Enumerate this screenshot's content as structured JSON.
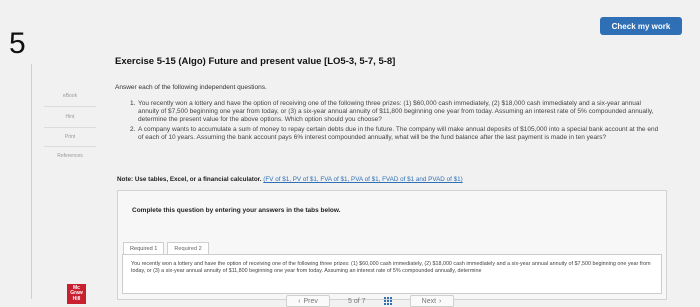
{
  "header": {
    "check_button": "Check my work",
    "question_number": "5"
  },
  "sidebar": {
    "items": [
      {
        "label": "eBook"
      },
      {
        "label": "Hint"
      },
      {
        "label": "Print"
      },
      {
        "label": "References"
      }
    ]
  },
  "exercise": {
    "title": "Exercise 5-15 (Algo) Future and present value [LO5-3, 5-7, 5-8]",
    "intro": "Answer each of the following independent questions.",
    "questions": [
      {
        "num": "1.",
        "text": "You recently won a lottery and have the option of receiving one of the following three prizes: (1) $60,000 cash immediately, (2) $18,000 cash immediately and a six-year annual annuity of $7,500 beginning one year from today, or (3) a six-year annual annuity of $11,800 beginning one year from today. Assuming an interest rate of 5% compounded annually, determine the present value for the above options. Which option should you choose?"
      },
      {
        "num": "2.",
        "text": "A company wants to accumulate a sum of money to repay certain debts due in the future. The company will make annual deposits of $105,000 into a special bank account at the end of each of 10 years. Assuming the bank account pays 6% interest compounded annually, what will be the fund balance after the last payment is made in ten years?"
      }
    ],
    "note_label": "Note: Use tables, Excel, or a financial calculator.",
    "note_links": "(FV of $1, PV of $1, FVA of $1, PVA of $1, FVAD of $1 and PVAD of $1)"
  },
  "answer_panel": {
    "instruction": "Complete this question by entering your answers in the tabs below.",
    "tabs": [
      {
        "label": "Required 1"
      },
      {
        "label": "Required 2"
      }
    ],
    "content": "You recently won a lottery and have the option of receiving one of the following three prizes: (1) $60,000 cash immediately, (2) $18,000 cash immediately and a six-year annual annuity of $7,500 beginning one year from today, or (3) a six-year annual annuity of $11,800 beginning one year from today. Assuming an interest rate of 5% compounded annually, determine"
  },
  "footer": {
    "prev_label": "Prev",
    "page_current": "5",
    "page_total": "7",
    "page_text": "5 of 7",
    "next_label": "Next",
    "logo_lines": [
      "Mc",
      "Graw",
      "Hill"
    ]
  }
}
